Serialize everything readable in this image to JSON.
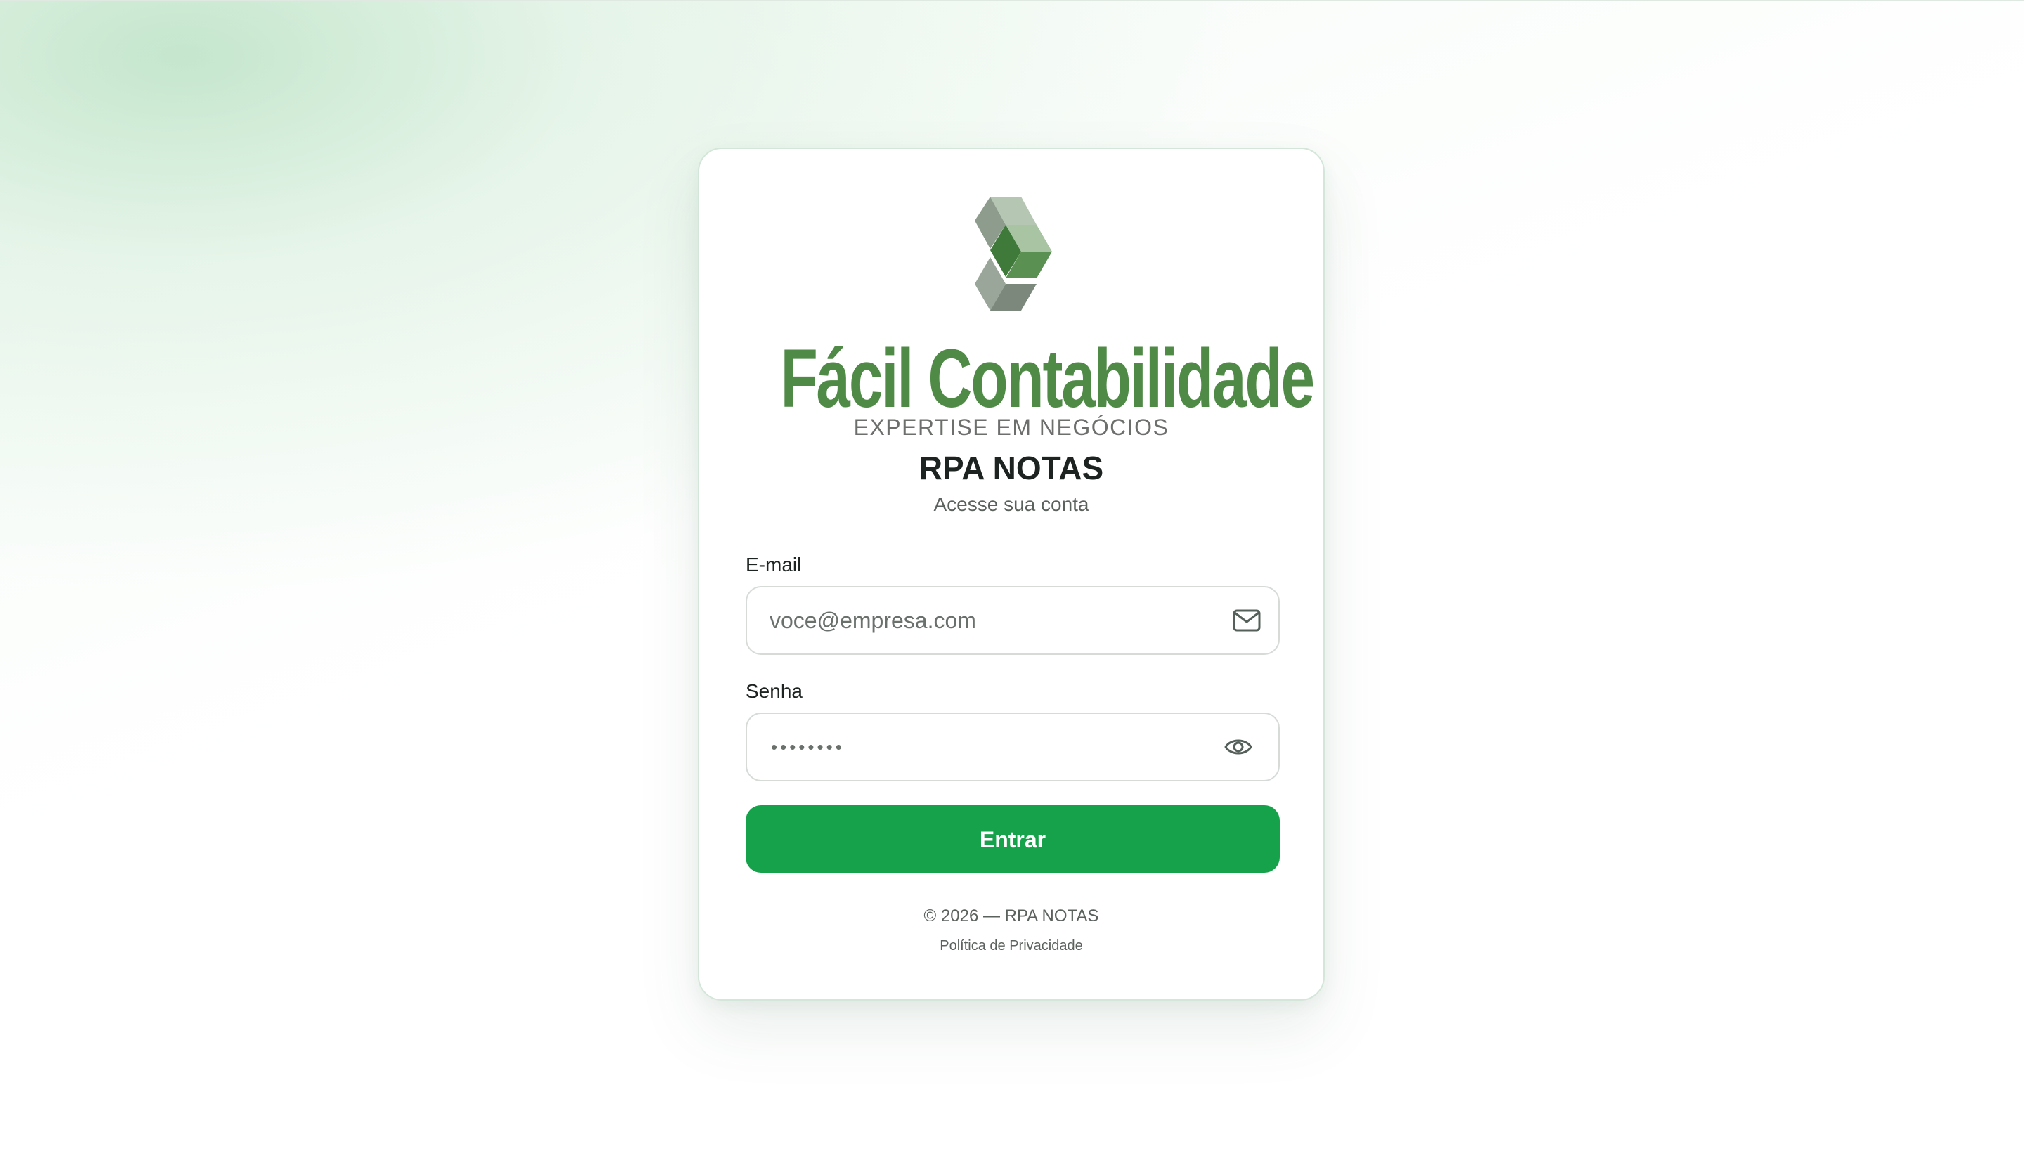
{
  "brand": {
    "name": "Fácil Contabilidade",
    "tagline": "EXPERTISE EM NEGÓCIOS",
    "logo_icon": "stacked-cubes-logo",
    "color_primary": "#4f8a46"
  },
  "app": {
    "title": "RPA NOTAS",
    "subtitle": "Acesse sua conta"
  },
  "form": {
    "email_label": "E-mail",
    "email_placeholder": "voce@empresa.com",
    "email_icon": "mail-icon",
    "password_label": "Senha",
    "password_value": "••••••••",
    "password_icon": "eye-icon",
    "submit_label": "Entrar",
    "submit_color": "#16a24a"
  },
  "footer": {
    "copyright": "© 2026 — RPA NOTAS",
    "privacy_link": "Política de Privacidade"
  }
}
